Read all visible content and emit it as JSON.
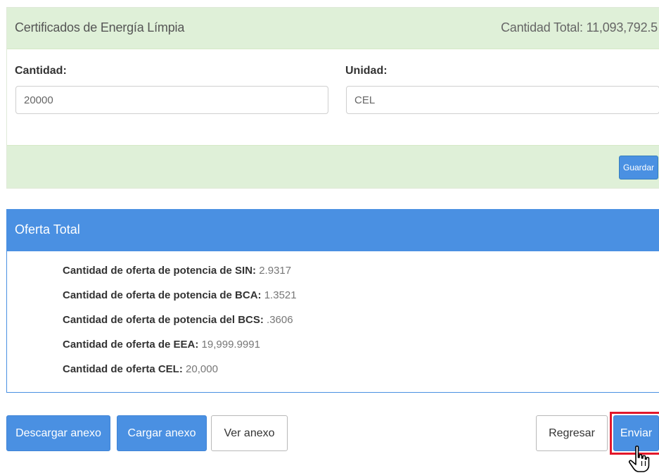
{
  "cel_panel": {
    "title": "Certificados de Energía Límpia",
    "total": "Cantidad Total: 11,093,792.5",
    "cantidad_label": "Cantidad:",
    "cantidad_value": "20000",
    "unidad_label": "Unidad:",
    "unidad_value": "CEL",
    "guardar_label": "Guardar"
  },
  "oferta_panel": {
    "title": "Oferta Total",
    "rows": [
      {
        "label": "Cantidad de oferta de potencia de SIN:",
        "value": "2.9317"
      },
      {
        "label": "Cantidad de oferta de potencia de BCA:",
        "value": "1.3521"
      },
      {
        "label": "Cantidad de oferta de potencia del BCS:",
        "value": ".3606"
      },
      {
        "label": "Cantidad de oferta de EEA:",
        "value": "19,999.9991"
      },
      {
        "label": "Cantidad de oferta CEL:",
        "value": "20,000"
      }
    ]
  },
  "actions": {
    "descargar": "Descargar anexo",
    "cargar": "Cargar anexo",
    "ver": "Ver anexo",
    "regresar": "Regresar",
    "enviar": "Enviar"
  },
  "colors": {
    "primary": "#4a90e2",
    "success_bg": "#dff0d8",
    "highlight": "#e3172a"
  },
  "icons": {
    "cursor": "hand-pointer-icon"
  }
}
